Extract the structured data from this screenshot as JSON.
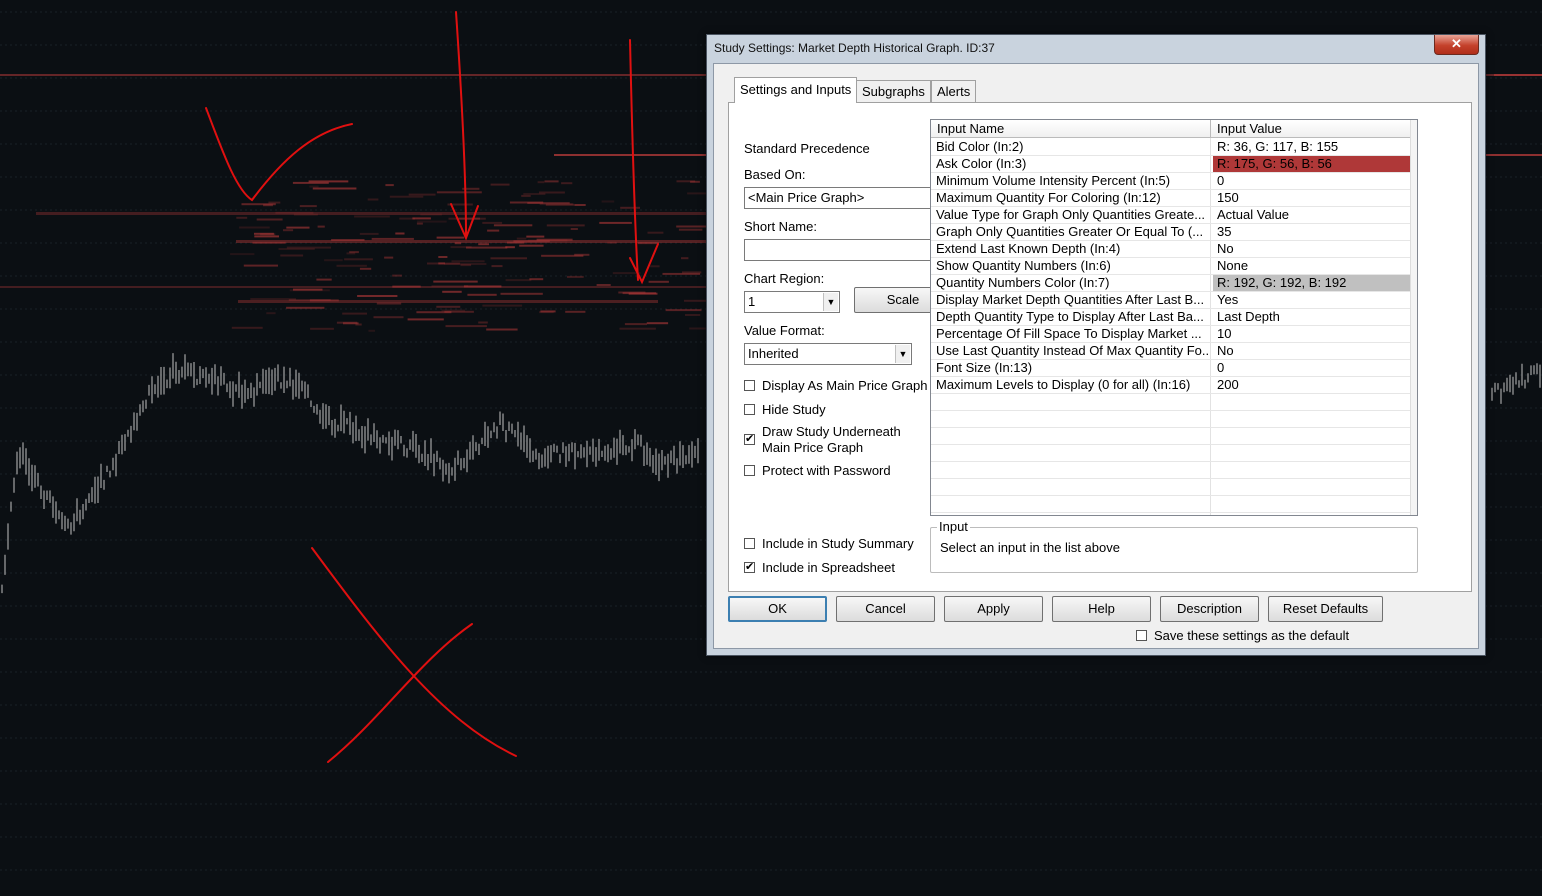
{
  "dialog": {
    "title": "Study Settings: Market Depth Historical Graph. ID:37",
    "close_glyph": "✕",
    "tabs": [
      {
        "label": "Settings and Inputs"
      },
      {
        "label": "Subgraphs"
      },
      {
        "label": "Alerts"
      }
    ],
    "left": {
      "standard_precedence_label": "Standard Precedence",
      "based_on_label": "Based On:",
      "based_on_value": "<Main Price Graph>",
      "short_name_label": "Short Name:",
      "short_name_value": "",
      "chart_region_label": "Chart Region:",
      "chart_region_value": "1",
      "scale_button": "Scale",
      "value_format_label": "Value Format:",
      "value_format_value": "Inherited",
      "checkboxes": [
        {
          "label": "Display As Main Price Graph",
          "checked": false
        },
        {
          "label": "Hide Study",
          "checked": false
        },
        {
          "label": "Draw Study Underneath",
          "label2": "Main Price Graph",
          "checked": true
        },
        {
          "label": "Protect with Password",
          "checked": false
        },
        {
          "label": "Include in Study Summary",
          "checked": false
        },
        {
          "label": "Include in Spreadsheet",
          "checked": true
        }
      ]
    },
    "table": {
      "header_name": "Input Name",
      "header_value": "Input Value",
      "rows": [
        {
          "name": "Bid Color  (In:2)",
          "value": "R: 36, G: 117, B: 155",
          "bg": ""
        },
        {
          "name": "Ask Color  (In:3)",
          "value": "R: 175, G: 56, B: 56",
          "bg": "#af3838"
        },
        {
          "name": "Minimum Volume Intensity Percent  (In:5)",
          "value": "0",
          "bg": ""
        },
        {
          "name": "Maximum Quantity For Coloring  (In:12)",
          "value": "150",
          "bg": ""
        },
        {
          "name": "Value Type for Graph Only Quantities Greate...",
          "value": "Actual Value",
          "bg": ""
        },
        {
          "name": "Graph Only Quantities Greater Or Equal To  (...",
          "value": "35",
          "bg": ""
        },
        {
          "name": "Extend Last Known Depth  (In:4)",
          "value": "No",
          "bg": ""
        },
        {
          "name": "Show Quantity Numbers  (In:6)",
          "value": "None",
          "bg": ""
        },
        {
          "name": "Quantity Numbers Color  (In:7)",
          "value": "R: 192, G: 192, B: 192",
          "bg": "#c0c0c0"
        },
        {
          "name": "Display Market Depth Quantities After Last B...",
          "value": "Yes",
          "bg": ""
        },
        {
          "name": "Depth Quantity Type to Display After Last Ba...",
          "value": "Last Depth",
          "bg": ""
        },
        {
          "name": "Percentage Of Fill Space To Display Market ...",
          "value": "10",
          "bg": ""
        },
        {
          "name": "Use Last Quantity Instead Of Max Quantity Fo...",
          "value": "No",
          "bg": ""
        },
        {
          "name": "Font Size  (In:13)",
          "value": "0",
          "bg": ""
        },
        {
          "name": "Maximum Levels to Display (0 for all)  (In:16)",
          "value": "200",
          "bg": ""
        }
      ]
    },
    "input_group": {
      "legend": "Input",
      "text": "Select an input in the list above"
    },
    "buttons": {
      "ok": "OK",
      "cancel": "Cancel",
      "apply": "Apply",
      "help": "Help",
      "description": "Description",
      "reset": "Reset Defaults"
    },
    "save_default_label": "Save these settings as the default",
    "save_default_checked": false
  },
  "colors": {
    "chart_bg": "#0b0f13",
    "depth_red": "#af3838",
    "price_bars": "#c0c0c0",
    "annotation": "#e01010"
  }
}
